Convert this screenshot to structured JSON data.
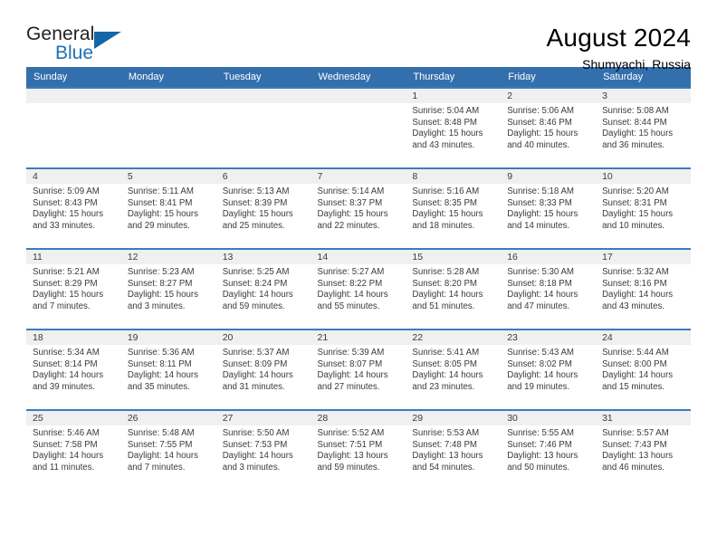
{
  "logo": {
    "word_one": "General",
    "word_two": "Blue",
    "triangle_color": "#1565a8",
    "blue_color": "#1a72b8"
  },
  "header": {
    "month_title": "August 2024",
    "location": "Shumyachi, Russia"
  },
  "theme": {
    "header_row_bg": "#346fad",
    "week_divider": "#3a7cbe",
    "daynum_strip_bg": "#f0f0f0"
  },
  "weekday_headers": [
    "Sunday",
    "Monday",
    "Tuesday",
    "Wednesday",
    "Thursday",
    "Friday",
    "Saturday"
  ],
  "weeks": [
    [
      {
        "day": "",
        "sunrise": "",
        "sunset": "",
        "daylight_line1": "",
        "daylight_line2": ""
      },
      {
        "day": "",
        "sunrise": "",
        "sunset": "",
        "daylight_line1": "",
        "daylight_line2": ""
      },
      {
        "day": "",
        "sunrise": "",
        "sunset": "",
        "daylight_line1": "",
        "daylight_line2": ""
      },
      {
        "day": "",
        "sunrise": "",
        "sunset": "",
        "daylight_line1": "",
        "daylight_line2": ""
      },
      {
        "day": "1",
        "sunrise": "Sunrise: 5:04 AM",
        "sunset": "Sunset: 8:48 PM",
        "daylight_line1": "Daylight: 15 hours",
        "daylight_line2": "and 43 minutes."
      },
      {
        "day": "2",
        "sunrise": "Sunrise: 5:06 AM",
        "sunset": "Sunset: 8:46 PM",
        "daylight_line1": "Daylight: 15 hours",
        "daylight_line2": "and 40 minutes."
      },
      {
        "day": "3",
        "sunrise": "Sunrise: 5:08 AM",
        "sunset": "Sunset: 8:44 PM",
        "daylight_line1": "Daylight: 15 hours",
        "daylight_line2": "and 36 minutes."
      }
    ],
    [
      {
        "day": "4",
        "sunrise": "Sunrise: 5:09 AM",
        "sunset": "Sunset: 8:43 PM",
        "daylight_line1": "Daylight: 15 hours",
        "daylight_line2": "and 33 minutes."
      },
      {
        "day": "5",
        "sunrise": "Sunrise: 5:11 AM",
        "sunset": "Sunset: 8:41 PM",
        "daylight_line1": "Daylight: 15 hours",
        "daylight_line2": "and 29 minutes."
      },
      {
        "day": "6",
        "sunrise": "Sunrise: 5:13 AM",
        "sunset": "Sunset: 8:39 PM",
        "daylight_line1": "Daylight: 15 hours",
        "daylight_line2": "and 25 minutes."
      },
      {
        "day": "7",
        "sunrise": "Sunrise: 5:14 AM",
        "sunset": "Sunset: 8:37 PM",
        "daylight_line1": "Daylight: 15 hours",
        "daylight_line2": "and 22 minutes."
      },
      {
        "day": "8",
        "sunrise": "Sunrise: 5:16 AM",
        "sunset": "Sunset: 8:35 PM",
        "daylight_line1": "Daylight: 15 hours",
        "daylight_line2": "and 18 minutes."
      },
      {
        "day": "9",
        "sunrise": "Sunrise: 5:18 AM",
        "sunset": "Sunset: 8:33 PM",
        "daylight_line1": "Daylight: 15 hours",
        "daylight_line2": "and 14 minutes."
      },
      {
        "day": "10",
        "sunrise": "Sunrise: 5:20 AM",
        "sunset": "Sunset: 8:31 PM",
        "daylight_line1": "Daylight: 15 hours",
        "daylight_line2": "and 10 minutes."
      }
    ],
    [
      {
        "day": "11",
        "sunrise": "Sunrise: 5:21 AM",
        "sunset": "Sunset: 8:29 PM",
        "daylight_line1": "Daylight: 15 hours",
        "daylight_line2": "and 7 minutes."
      },
      {
        "day": "12",
        "sunrise": "Sunrise: 5:23 AM",
        "sunset": "Sunset: 8:27 PM",
        "daylight_line1": "Daylight: 15 hours",
        "daylight_line2": "and 3 minutes."
      },
      {
        "day": "13",
        "sunrise": "Sunrise: 5:25 AM",
        "sunset": "Sunset: 8:24 PM",
        "daylight_line1": "Daylight: 14 hours",
        "daylight_line2": "and 59 minutes."
      },
      {
        "day": "14",
        "sunrise": "Sunrise: 5:27 AM",
        "sunset": "Sunset: 8:22 PM",
        "daylight_line1": "Daylight: 14 hours",
        "daylight_line2": "and 55 minutes."
      },
      {
        "day": "15",
        "sunrise": "Sunrise: 5:28 AM",
        "sunset": "Sunset: 8:20 PM",
        "daylight_line1": "Daylight: 14 hours",
        "daylight_line2": "and 51 minutes."
      },
      {
        "day": "16",
        "sunrise": "Sunrise: 5:30 AM",
        "sunset": "Sunset: 8:18 PM",
        "daylight_line1": "Daylight: 14 hours",
        "daylight_line2": "and 47 minutes."
      },
      {
        "day": "17",
        "sunrise": "Sunrise: 5:32 AM",
        "sunset": "Sunset: 8:16 PM",
        "daylight_line1": "Daylight: 14 hours",
        "daylight_line2": "and 43 minutes."
      }
    ],
    [
      {
        "day": "18",
        "sunrise": "Sunrise: 5:34 AM",
        "sunset": "Sunset: 8:14 PM",
        "daylight_line1": "Daylight: 14 hours",
        "daylight_line2": "and 39 minutes."
      },
      {
        "day": "19",
        "sunrise": "Sunrise: 5:36 AM",
        "sunset": "Sunset: 8:11 PM",
        "daylight_line1": "Daylight: 14 hours",
        "daylight_line2": "and 35 minutes."
      },
      {
        "day": "20",
        "sunrise": "Sunrise: 5:37 AM",
        "sunset": "Sunset: 8:09 PM",
        "daylight_line1": "Daylight: 14 hours",
        "daylight_line2": "and 31 minutes."
      },
      {
        "day": "21",
        "sunrise": "Sunrise: 5:39 AM",
        "sunset": "Sunset: 8:07 PM",
        "daylight_line1": "Daylight: 14 hours",
        "daylight_line2": "and 27 minutes."
      },
      {
        "day": "22",
        "sunrise": "Sunrise: 5:41 AM",
        "sunset": "Sunset: 8:05 PM",
        "daylight_line1": "Daylight: 14 hours",
        "daylight_line2": "and 23 minutes."
      },
      {
        "day": "23",
        "sunrise": "Sunrise: 5:43 AM",
        "sunset": "Sunset: 8:02 PM",
        "daylight_line1": "Daylight: 14 hours",
        "daylight_line2": "and 19 minutes."
      },
      {
        "day": "24",
        "sunrise": "Sunrise: 5:44 AM",
        "sunset": "Sunset: 8:00 PM",
        "daylight_line1": "Daylight: 14 hours",
        "daylight_line2": "and 15 minutes."
      }
    ],
    [
      {
        "day": "25",
        "sunrise": "Sunrise: 5:46 AM",
        "sunset": "Sunset: 7:58 PM",
        "daylight_line1": "Daylight: 14 hours",
        "daylight_line2": "and 11 minutes."
      },
      {
        "day": "26",
        "sunrise": "Sunrise: 5:48 AM",
        "sunset": "Sunset: 7:55 PM",
        "daylight_line1": "Daylight: 14 hours",
        "daylight_line2": "and 7 minutes."
      },
      {
        "day": "27",
        "sunrise": "Sunrise: 5:50 AM",
        "sunset": "Sunset: 7:53 PM",
        "daylight_line1": "Daylight: 14 hours",
        "daylight_line2": "and 3 minutes."
      },
      {
        "day": "28",
        "sunrise": "Sunrise: 5:52 AM",
        "sunset": "Sunset: 7:51 PM",
        "daylight_line1": "Daylight: 13 hours",
        "daylight_line2": "and 59 minutes."
      },
      {
        "day": "29",
        "sunrise": "Sunrise: 5:53 AM",
        "sunset": "Sunset: 7:48 PM",
        "daylight_line1": "Daylight: 13 hours",
        "daylight_line2": "and 54 minutes."
      },
      {
        "day": "30",
        "sunrise": "Sunrise: 5:55 AM",
        "sunset": "Sunset: 7:46 PM",
        "daylight_line1": "Daylight: 13 hours",
        "daylight_line2": "and 50 minutes."
      },
      {
        "day": "31",
        "sunrise": "Sunrise: 5:57 AM",
        "sunset": "Sunset: 7:43 PM",
        "daylight_line1": "Daylight: 13 hours",
        "daylight_line2": "and 46 minutes."
      }
    ]
  ]
}
